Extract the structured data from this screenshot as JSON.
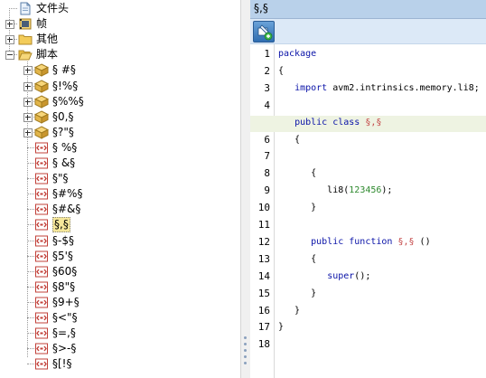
{
  "tree": {
    "items": [
      {
        "label": "文件头",
        "icon": "document-icon",
        "expander": "none",
        "level": 0
      },
      {
        "label": "帧",
        "icon": "film-frame-icon",
        "expander": "plus",
        "level": 0
      },
      {
        "label": "其他",
        "icon": "folder-icon",
        "expander": "plus",
        "level": 0
      },
      {
        "label": "脚本",
        "icon": "folder-open-icon",
        "expander": "minus",
        "level": 0
      },
      {
        "label": "§ #§",
        "icon": "package-icon",
        "expander": "plus",
        "level": 1
      },
      {
        "label": "§!%§",
        "icon": "package-icon",
        "expander": "plus",
        "level": 1
      },
      {
        "label": "§%%§",
        "icon": "package-icon",
        "expander": "plus",
        "level": 1
      },
      {
        "label": "§0,§",
        "icon": "package-icon",
        "expander": "plus",
        "level": 1
      },
      {
        "label": "§?\"§",
        "icon": "package-icon",
        "expander": "plus",
        "level": 1
      },
      {
        "label": "§ %§",
        "icon": "script-icon",
        "expander": "none",
        "level": 1
      },
      {
        "label": "§ &§",
        "icon": "script-icon",
        "expander": "none",
        "level": 1
      },
      {
        "label": "§\"§",
        "icon": "script-icon",
        "expander": "none",
        "level": 1
      },
      {
        "label": "§#%§",
        "icon": "script-icon",
        "expander": "none",
        "level": 1
      },
      {
        "label": "§#&§",
        "icon": "script-icon",
        "expander": "none",
        "level": 1
      },
      {
        "label": "§,§",
        "icon": "script-icon",
        "expander": "none",
        "level": 1,
        "selected": true
      },
      {
        "label": "§-$§",
        "icon": "script-icon",
        "expander": "none",
        "level": 1
      },
      {
        "label": "§5'§",
        "icon": "script-icon",
        "expander": "none",
        "level": 1
      },
      {
        "label": "§60§",
        "icon": "script-icon",
        "expander": "none",
        "level": 1
      },
      {
        "label": "§8\"§",
        "icon": "script-icon",
        "expander": "none",
        "level": 1
      },
      {
        "label": "§9+§",
        "icon": "script-icon",
        "expander": "none",
        "level": 1
      },
      {
        "label": "§<\"§",
        "icon": "script-icon",
        "expander": "none",
        "level": 1
      },
      {
        "label": "§=,§",
        "icon": "script-icon",
        "expander": "none",
        "level": 1
      },
      {
        "label": "§>-§",
        "icon": "script-icon",
        "expander": "none",
        "level": 1
      },
      {
        "label": "§[!§",
        "icon": "script-icon",
        "expander": "none",
        "level": 1
      }
    ]
  },
  "editor": {
    "tab_title": "§,§",
    "toolbar_icon": "edit-script-icon",
    "highlight_line": 5,
    "line_numbers": [
      "1",
      "2",
      "3",
      "4",
      "5",
      "6",
      "7",
      "8",
      "9",
      "10",
      "11",
      "12",
      "13",
      "14",
      "15",
      "16",
      "17",
      "18"
    ],
    "lines": [
      [
        {
          "t": "package",
          "c": "kw"
        }
      ],
      [
        {
          "t": "{",
          "c": ""
        }
      ],
      [
        {
          "t": "   ",
          "c": ""
        },
        {
          "t": "import",
          "c": "kw"
        },
        {
          "t": " avm2.intrinsics.memory.li8;",
          "c": ""
        }
      ],
      [],
      [
        {
          "t": "   ",
          "c": ""
        },
        {
          "t": "public class",
          "c": "kw"
        },
        {
          "t": " ",
          "c": ""
        },
        {
          "t": "§,§",
          "c": "spc"
        }
      ],
      [
        {
          "t": "   {",
          "c": ""
        }
      ],
      [],
      [
        {
          "t": "      {",
          "c": ""
        }
      ],
      [
        {
          "t": "         li8(",
          "c": ""
        },
        {
          "t": "123456",
          "c": "num"
        },
        {
          "t": ");",
          "c": ""
        }
      ],
      [
        {
          "t": "      }",
          "c": ""
        }
      ],
      [],
      [
        {
          "t": "      ",
          "c": ""
        },
        {
          "t": "public function",
          "c": "kw"
        },
        {
          "t": " ",
          "c": ""
        },
        {
          "t": "§,§",
          "c": "spc"
        },
        {
          "t": " ()",
          "c": ""
        }
      ],
      [
        {
          "t": "      {",
          "c": ""
        }
      ],
      [
        {
          "t": "         ",
          "c": ""
        },
        {
          "t": "super",
          "c": "kw"
        },
        {
          "t": "();",
          "c": ""
        }
      ],
      [
        {
          "t": "      }",
          "c": ""
        }
      ],
      [
        {
          "t": "   }",
          "c": ""
        }
      ],
      [
        {
          "t": "}",
          "c": ""
        }
      ],
      []
    ]
  },
  "colors": {
    "keyword": "#0a13a8",
    "number": "#2f8a2f",
    "special_name": "#c44848",
    "current_line": "#eef3e2",
    "tab_header": "#b9d1ea"
  }
}
